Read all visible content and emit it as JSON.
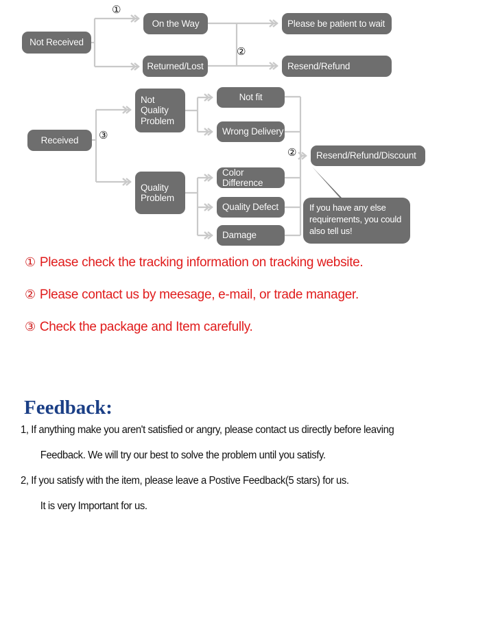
{
  "flowchart": {
    "nodes": {
      "not_received": "Not Received",
      "on_the_way": "On the Way",
      "returned_lost": "Returned/Lost",
      "please_wait": "Please be patient to wait",
      "resend_refund": "Resend/Refund",
      "received": "Received",
      "not_quality_problem": "Not\nQuality\nProblem",
      "quality_problem": "Quality\nProblem",
      "not_fit": "Not fit",
      "wrong_delivery": "Wrong Delivery",
      "color_difference": "Color Difference",
      "quality_defect": "Quality Defect",
      "damage": "Damage",
      "resend_refund_discount": "Resend/Refund/Discount"
    },
    "bubble": "If you have any else\nrequirements, you could\nalso tell us!",
    "markers": {
      "m1": "①",
      "m2_top": "②",
      "m3": "③",
      "m2_bottom": "②"
    },
    "colors": {
      "node_fill": "#6e6e6e",
      "node_text": "#ffffff",
      "connector": "#c9c9c9",
      "note_red": "#e01b1b",
      "feedback_blue": "#1b3f86"
    }
  },
  "notes": [
    {
      "num": "①",
      "text": "Please check the tracking information on tracking website."
    },
    {
      "num": "②",
      "text": "Please contact us by meesage, e-mail, or trade manager."
    },
    {
      "num": "③",
      "text": "Check the package and Item carefully."
    }
  ],
  "feedback": {
    "title": "Feedback:",
    "lines": [
      "1, If anything make you aren't satisfied or angry, please contact us directly before leaving",
      "Feedback. We will try our best to solve the problem until you satisfy.",
      "2, If you satisfy with the item, please leave a Postive Feedback(5 stars) for us.",
      "It is very Important for us."
    ]
  }
}
